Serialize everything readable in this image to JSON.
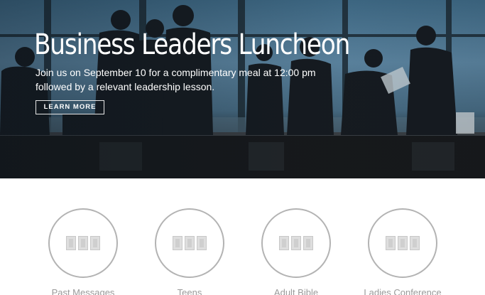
{
  "hero": {
    "title": "Business Leaders Luncheon",
    "description_line1": " Join us on September 10 for a complimentary meal at 12:00 pm",
    "description_line2": "followed by a relevant leadership lesson.",
    "button_label": "LEARN MORE"
  },
  "features": [
    {
      "label": "Past Messages",
      "icon": "placeholder-icon"
    },
    {
      "label": "Teens",
      "icon": "placeholder-icon"
    },
    {
      "label": "Adult Bible",
      "icon": "placeholder-icon"
    },
    {
      "label": "Ladies Conference",
      "icon": "placeholder-icon"
    }
  ],
  "colors": {
    "circle_border": "#b3b3b3",
    "label_text": "#9a9a9a",
    "hero_text": "#ffffff"
  }
}
